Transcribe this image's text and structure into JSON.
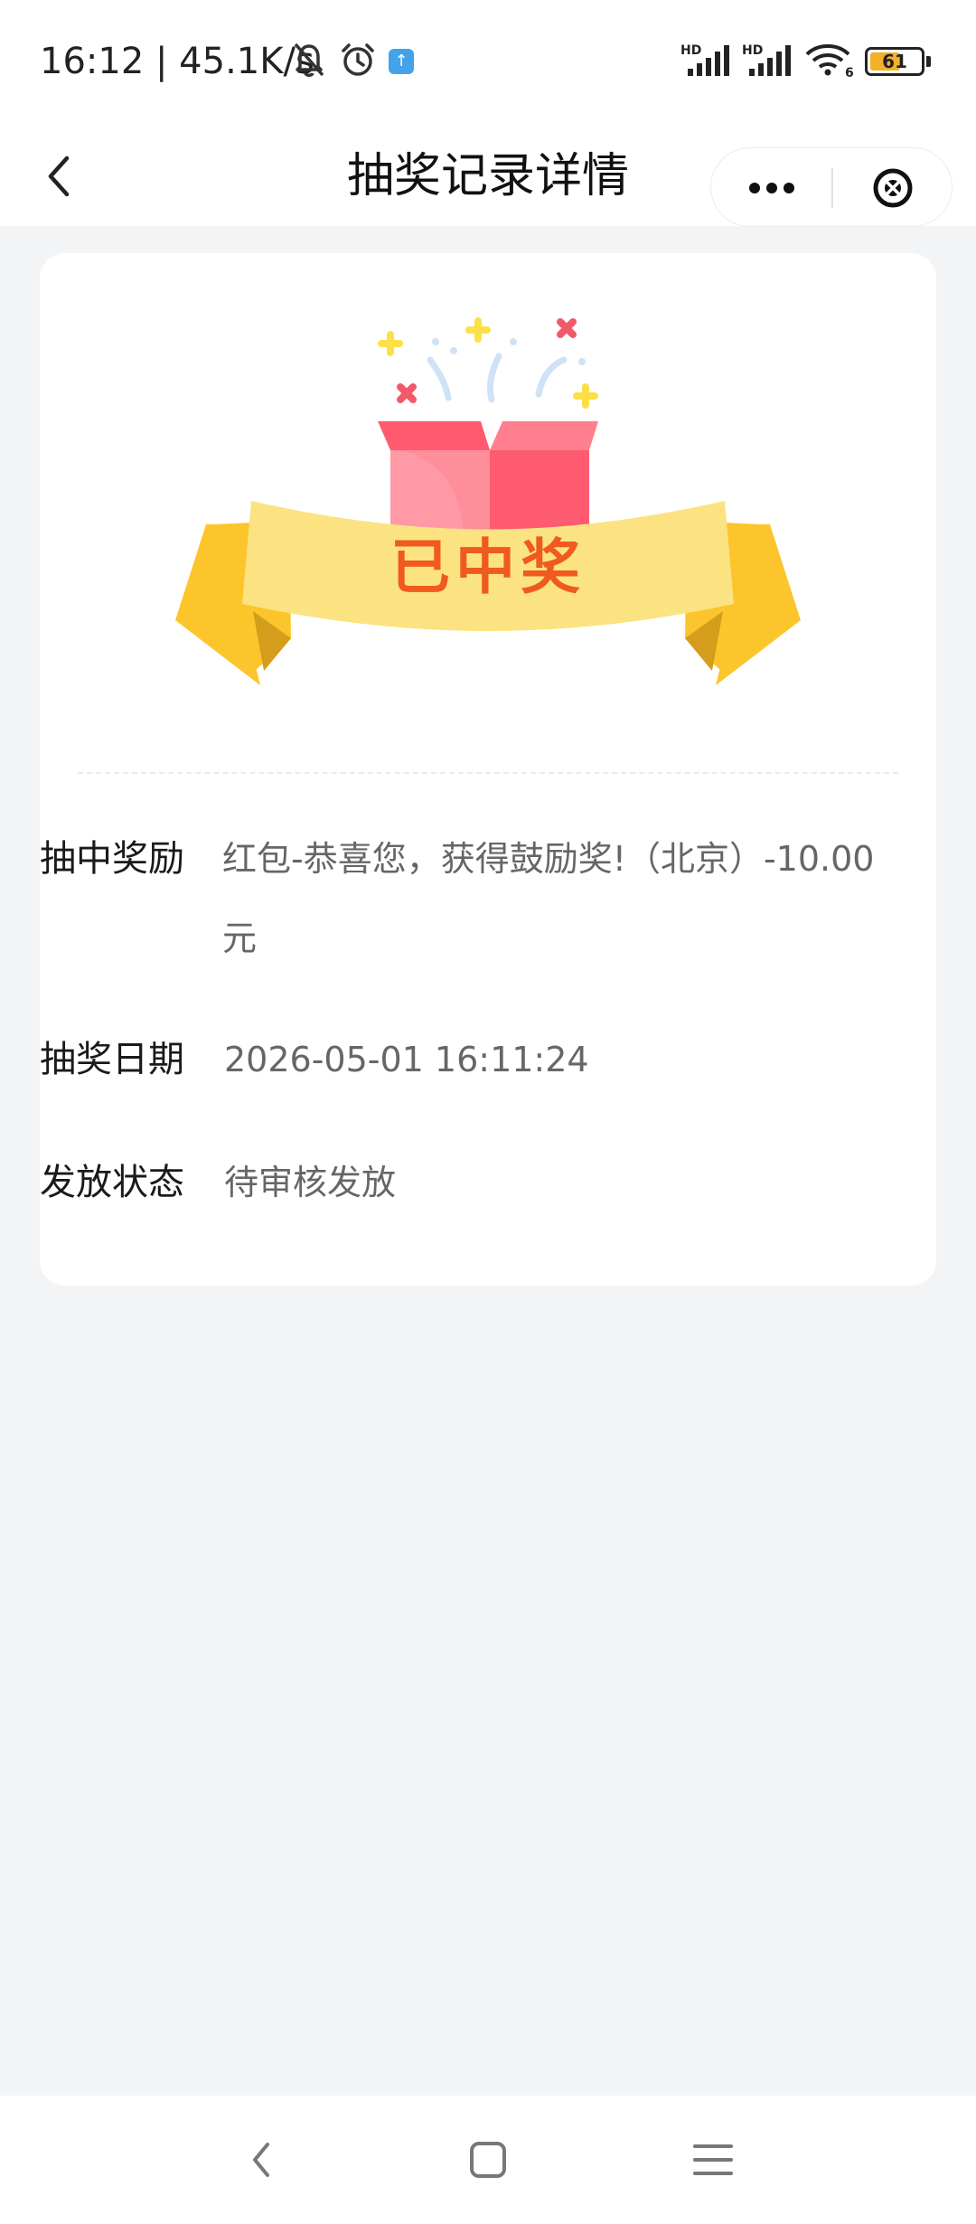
{
  "status_bar": {
    "time_and_speed": "16:12 | 45.1K/s",
    "battery": "61",
    "battery_level": 0.61,
    "icons": [
      "bell-off-icon",
      "alarm-icon",
      "app-notification-icon",
      "signal-hd-icon",
      "signal-hd-icon",
      "wifi-icon",
      "battery-icon"
    ],
    "signal_hd_label": "HD",
    "wifi_label": "6"
  },
  "header": {
    "title": "抽奖记录详情",
    "back_icon": "chevron-left-icon",
    "more_icon": "more-dots-icon",
    "close_icon": "circle-close-icon"
  },
  "result": {
    "banner_text": "已中奖",
    "illustration": "gift-box-ribbon"
  },
  "details": {
    "prize_label": "抽中奖励",
    "prize_value": "红包-恭喜您，获得鼓励奖!（北京）-10.00元",
    "date_label": "抽奖日期",
    "date_value": "2026-05-01 16:11:24",
    "status_label": "发放状态",
    "status_value": "待审核发放"
  },
  "colors": {
    "accent_text": "#f05a1e",
    "ribbon": "#fbe382",
    "ribbon_tail": "#fcc52c",
    "gift_box": "#ff5a6e",
    "page_bg": "#f3f4f6"
  },
  "system_nav": {
    "icons": [
      "back-triangle-icon",
      "home-square-icon",
      "menu-lines-icon"
    ]
  }
}
